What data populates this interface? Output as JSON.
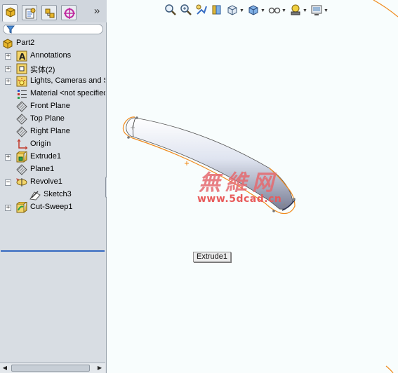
{
  "panel": {
    "tabs": [
      {
        "name": "feature-manager-tab",
        "icon": "feature-manager-icon"
      },
      {
        "name": "property-manager-tab",
        "icon": "property-manager-icon"
      },
      {
        "name": "configuration-manager-tab",
        "icon": "configuration-manager-icon"
      },
      {
        "name": "dimxpert-manager-tab",
        "icon": "dimxpert-icon"
      }
    ],
    "more_label": "»",
    "filter_icon": "filter-icon",
    "tree": [
      {
        "label": "Part2",
        "icon": "part-icon",
        "expander": ""
      },
      {
        "label": "Annotations",
        "icon": "annotations-icon",
        "expander": "+"
      },
      {
        "label": "实体(2)",
        "icon": "solid-bodies-icon",
        "expander": "+"
      },
      {
        "label": "Lights, Cameras and Scene",
        "icon": "lights-icon",
        "expander": "+"
      },
      {
        "label": "Material <not specified>",
        "icon": "material-icon",
        "expander": ""
      },
      {
        "label": "Front Plane",
        "icon": "plane-icon",
        "expander": ""
      },
      {
        "label": "Top Plane",
        "icon": "plane-icon",
        "expander": ""
      },
      {
        "label": "Right Plane",
        "icon": "plane-icon",
        "expander": ""
      },
      {
        "label": "Origin",
        "icon": "origin-icon",
        "expander": ""
      },
      {
        "label": "Extrude1",
        "icon": "extrude-icon",
        "expander": "+"
      },
      {
        "label": "Plane1",
        "icon": "plane-icon",
        "expander": ""
      },
      {
        "label": "Revolve1",
        "icon": "revolve-icon",
        "expander": "−"
      },
      {
        "label": "Sketch3",
        "icon": "sketch-icon",
        "expander": ""
      },
      {
        "label": "Cut-Sweep1",
        "icon": "cut-sweep-icon",
        "expander": "+"
      }
    ]
  },
  "view": {
    "toolbar": [
      "zoom-to-fit-icon",
      "zoom-to-area-icon",
      "previous-view-icon",
      "section-view-icon",
      "view-orientation-icon",
      "display-style-icon",
      "hide-show-items-icon",
      "edit-appearance-icon",
      "apply-scene-icon"
    ],
    "tooltip": "Extrude1",
    "watermark_cn": "無維网",
    "watermark_url": "www.5dcad.cn"
  },
  "colors": {
    "highlight_edge": "#f08a1c",
    "panel_bg": "#d8dde3",
    "view_bg": "#f8fdfd",
    "watermark": "#e66a6f"
  }
}
